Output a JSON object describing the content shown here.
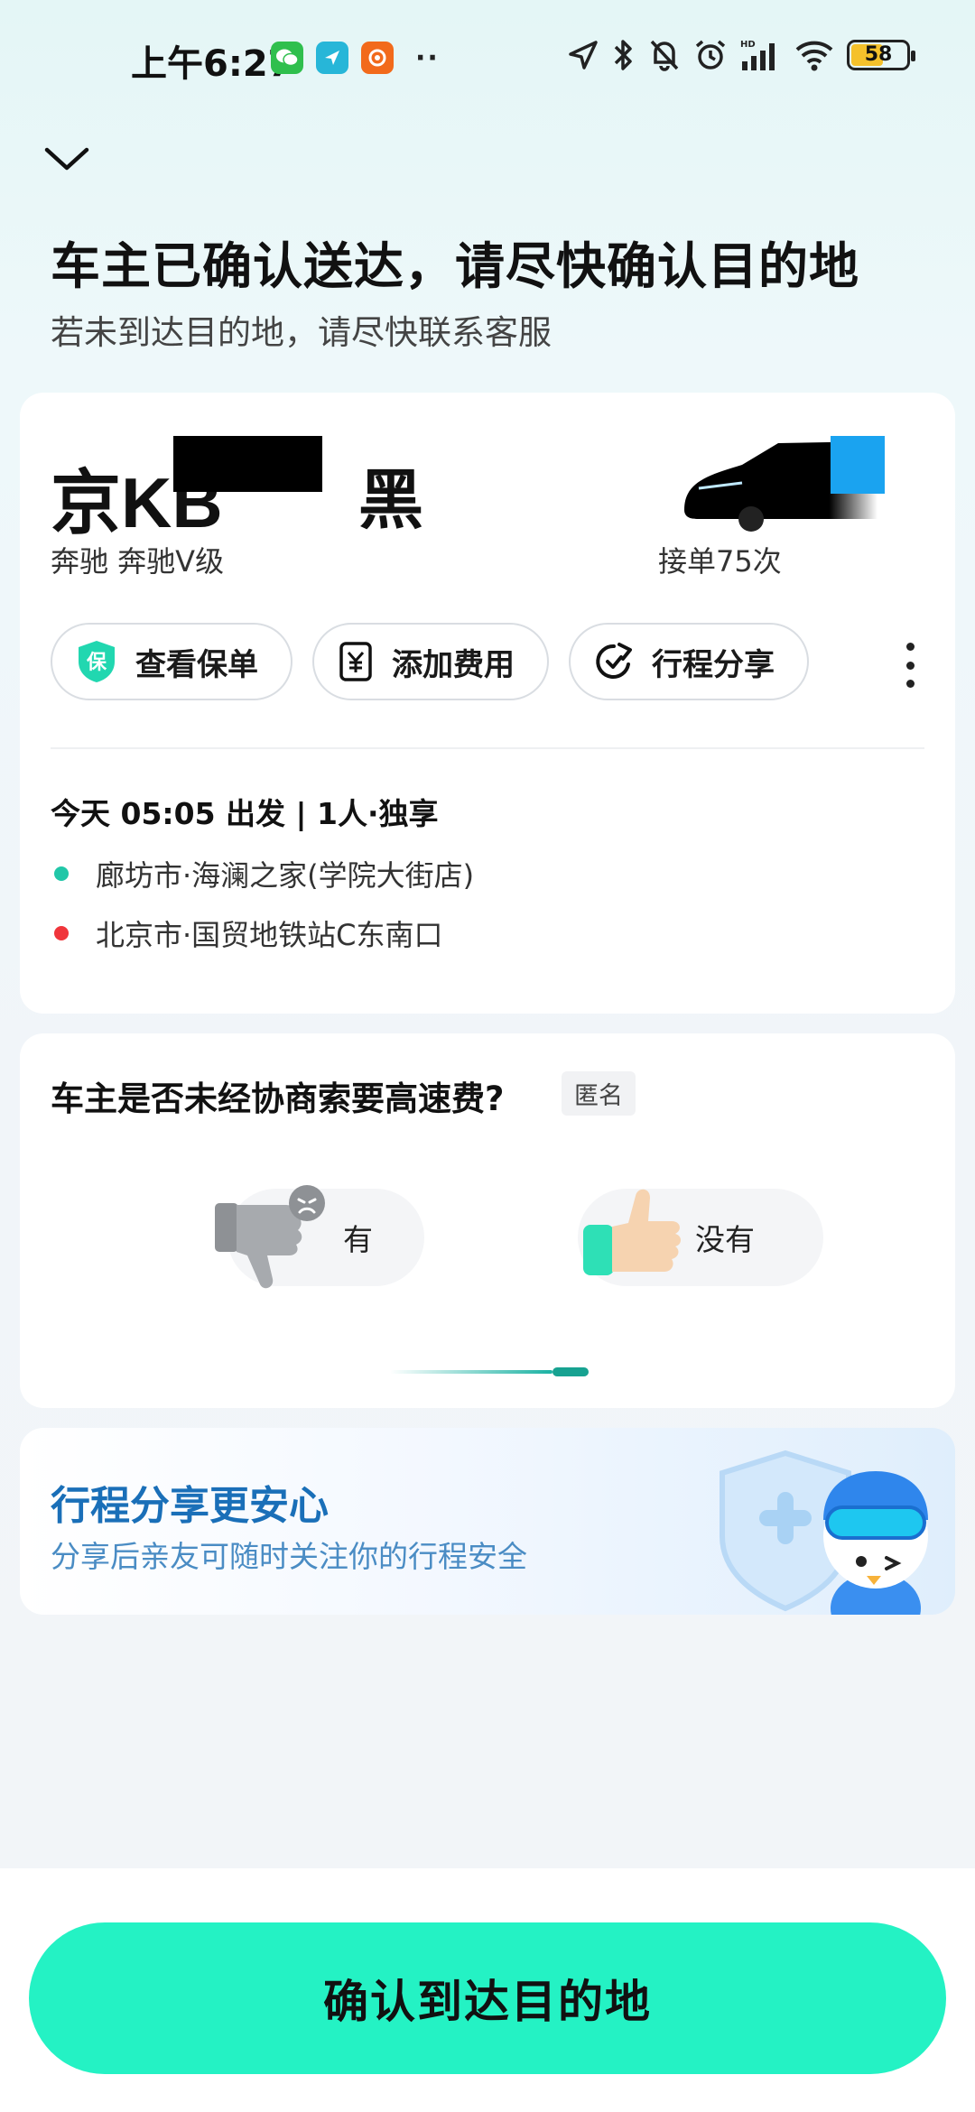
{
  "status_bar": {
    "time": "上午6:27",
    "app_icons": [
      "wechat-icon",
      "location-app-icon",
      "orange-app-icon"
    ],
    "more": "··",
    "battery": "58"
  },
  "header": {
    "title": "车主已确认送达，请尽快确认目的地",
    "subtitle": "若未到达目的地，请尽快联系客服"
  },
  "driver_card": {
    "plate": "京KB",
    "plate_hidden": true,
    "car_color": "黑",
    "car_model": "奔驰 奔驰V级",
    "order_count": "接单75次",
    "actions": [
      {
        "label": "查看保单",
        "icon": "insurance-shield-icon"
      },
      {
        "label": "添加费用",
        "icon": "fee-yuan-icon"
      },
      {
        "label": "行程分享",
        "icon": "share-trip-icon"
      }
    ],
    "departure": "今天 05:05 出发 | 1人·独享",
    "route": {
      "origin": "廊坊市·海澜之家(学院大街店)",
      "destination": "北京市·国贸地铁站C东南口",
      "origin_color": "#21c7a8",
      "destination_color": "#f0353b"
    }
  },
  "fee_card": {
    "question": "车主是否未经协商索要高速费?",
    "anonymous_tag": "匿名",
    "option_yes": "有",
    "option_no": "没有"
  },
  "share_card": {
    "title": "行程分享更安心",
    "subtitle": "分享后亲友可随时关注你的行程安全"
  },
  "confirm_button": "确认到达目的地",
  "colors": {
    "accent": "#24f2c4",
    "share_blue": "#1a6fb8"
  }
}
